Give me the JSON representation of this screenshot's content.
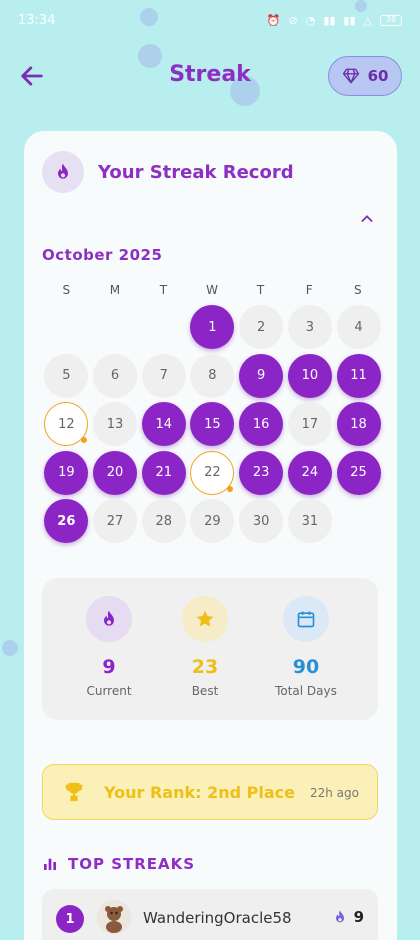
{
  "status": {
    "time": "13:34",
    "battery": "38"
  },
  "header": {
    "title": "Streak",
    "gems": "60"
  },
  "card": {
    "title": "Your Streak Record"
  },
  "calendar": {
    "month": "October 2025",
    "weekdays": [
      "S",
      "M",
      "T",
      "W",
      "T",
      "F",
      "S"
    ],
    "first_weekday_index": 3,
    "days": [
      {
        "n": "1",
        "state": "active"
      },
      {
        "n": "2",
        "state": "none"
      },
      {
        "n": "3",
        "state": "none"
      },
      {
        "n": "4",
        "state": "none"
      },
      {
        "n": "5",
        "state": "none"
      },
      {
        "n": "6",
        "state": "none"
      },
      {
        "n": "7",
        "state": "none"
      },
      {
        "n": "8",
        "state": "none"
      },
      {
        "n": "9",
        "state": "active"
      },
      {
        "n": "10",
        "state": "active"
      },
      {
        "n": "11",
        "state": "active"
      },
      {
        "n": "12",
        "state": "missed"
      },
      {
        "n": "13",
        "state": "none"
      },
      {
        "n": "14",
        "state": "active"
      },
      {
        "n": "15",
        "state": "active"
      },
      {
        "n": "16",
        "state": "active"
      },
      {
        "n": "17",
        "state": "none"
      },
      {
        "n": "18",
        "state": "active"
      },
      {
        "n": "19",
        "state": "active"
      },
      {
        "n": "20",
        "state": "active"
      },
      {
        "n": "21",
        "state": "active"
      },
      {
        "n": "22",
        "state": "missed"
      },
      {
        "n": "23",
        "state": "active"
      },
      {
        "n": "24",
        "state": "active"
      },
      {
        "n": "25",
        "state": "active"
      },
      {
        "n": "26",
        "state": "today"
      },
      {
        "n": "27",
        "state": "none"
      },
      {
        "n": "28",
        "state": "none"
      },
      {
        "n": "29",
        "state": "none"
      },
      {
        "n": "30",
        "state": "none"
      },
      {
        "n": "31",
        "state": "none"
      }
    ]
  },
  "stats": [
    {
      "value": "9",
      "label": "Current",
      "color": "#8b25c6",
      "icon": "flame-icon"
    },
    {
      "value": "23",
      "label": "Best",
      "color": "#efbf18",
      "icon": "star-icon"
    },
    {
      "value": "90",
      "label": "Total Days",
      "color": "#2b8fd6",
      "icon": "calendar-icon"
    }
  ],
  "rank": {
    "text": "Your Rank: 2nd Place",
    "time": "22h ago"
  },
  "leaderboard": {
    "title": "TOP STREAKS",
    "rows": [
      {
        "rank": "1",
        "name": "WanderingOracle58",
        "streak": "9"
      }
    ]
  },
  "colors": {
    "accent": "#8b25c6",
    "missed": "#f0a21b",
    "background": "#b9eeee"
  }
}
